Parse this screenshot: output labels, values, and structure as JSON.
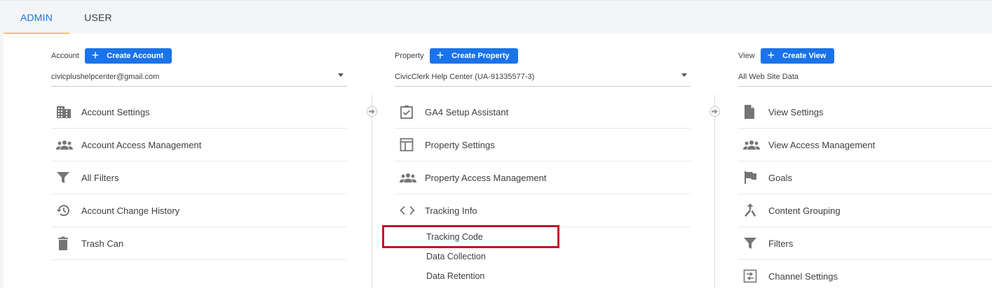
{
  "tabs": [
    {
      "label": "ADMIN",
      "active": true
    },
    {
      "label": "USER",
      "active": false
    }
  ],
  "account": {
    "label": "Account",
    "create_label": "Create Account",
    "selected": "civicplushelpcenter@gmail.com",
    "items": [
      {
        "label": "Account Settings",
        "icon": "building-icon"
      },
      {
        "label": "Account Access Management",
        "icon": "people-icon"
      },
      {
        "label": "All Filters",
        "icon": "filter-icon"
      },
      {
        "label": "Account Change History",
        "icon": "history-icon"
      },
      {
        "label": "Trash Can",
        "icon": "trash-icon"
      }
    ]
  },
  "property": {
    "label": "Property",
    "create_label": "Create Property",
    "selected": "CivicClerk Help Center (UA-91335577-3)",
    "items": [
      {
        "label": "GA4 Setup Assistant",
        "icon": "clipboard-check-icon"
      },
      {
        "label": "Property Settings",
        "icon": "layout-icon"
      },
      {
        "label": "Property Access Management",
        "icon": "people-icon"
      },
      {
        "label": "Tracking Info",
        "icon": "code-icon"
      }
    ],
    "sub_items": [
      {
        "label": "Tracking Code"
      },
      {
        "label": "Data Collection"
      },
      {
        "label": "Data Retention"
      }
    ]
  },
  "view": {
    "label": "View",
    "create_label": "Create View",
    "selected": "All Web Site Data",
    "items": [
      {
        "label": "View Settings",
        "icon": "document-icon"
      },
      {
        "label": "View Access Management",
        "icon": "people-icon"
      },
      {
        "label": "Goals",
        "icon": "flag-icon"
      },
      {
        "label": "Content Grouping",
        "icon": "merge-icon"
      },
      {
        "label": "Filters",
        "icon": "filter-icon"
      },
      {
        "label": "Channel Settings",
        "icon": "channel-icon"
      }
    ]
  },
  "colors": {
    "accent": "#1a73e8",
    "tab_underline": "#f29900",
    "highlight": "#c5122b",
    "icon": "#757575"
  }
}
